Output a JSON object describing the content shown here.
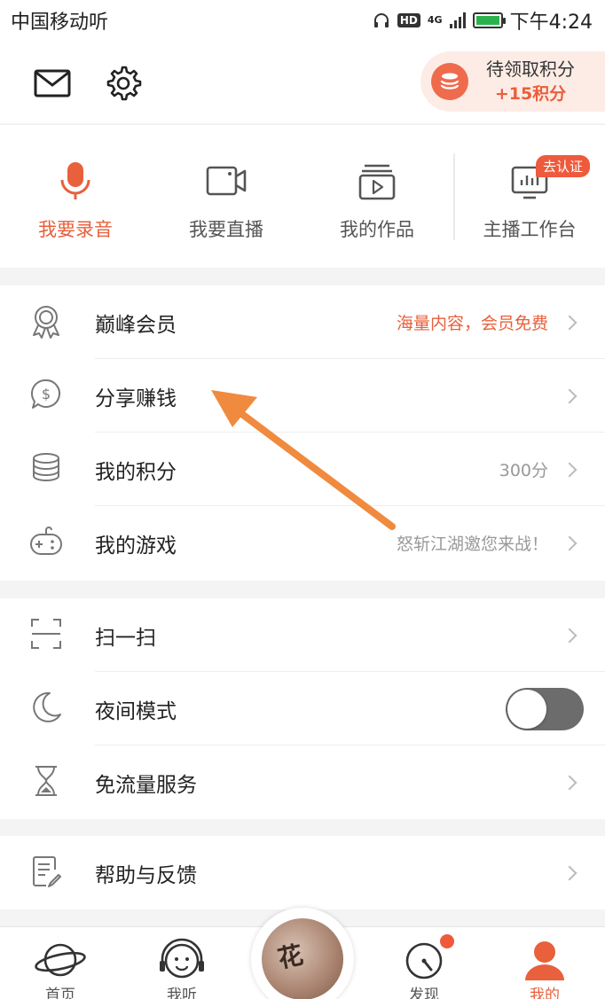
{
  "status_bar": {
    "carrier": "中国移动听",
    "hd": "HD",
    "network": "4G",
    "time": "下午4:24"
  },
  "header": {
    "points_title": "待领取积分",
    "points_value": "+15积分"
  },
  "quick_actions": [
    {
      "label": "我要录音",
      "icon": "microphone-icon"
    },
    {
      "label": "我要直播",
      "icon": "video-camera-icon"
    },
    {
      "label": "我的作品",
      "icon": "play-works-icon"
    },
    {
      "label": "主播工作台",
      "icon": "studio-monitor-icon",
      "badge": "去认证"
    }
  ],
  "menu_group_1": [
    {
      "title": "巅峰会员",
      "sub": "海量内容，会员免费",
      "icon": "medal-icon"
    },
    {
      "title": "分享赚钱",
      "sub": "",
      "icon": "dollar-bubble-icon"
    },
    {
      "title": "我的积分",
      "sub": "300分",
      "icon": "coin-stack-icon"
    },
    {
      "title": "我的游戏",
      "sub": "怒斩江湖邀您来战！",
      "icon": "gamepad-icon"
    }
  ],
  "menu_group_2": [
    {
      "title": "扫一扫",
      "icon": "scan-icon"
    },
    {
      "title": "夜间模式",
      "icon": "moon-icon",
      "toggle": false
    },
    {
      "title": "免流量服务",
      "icon": "hourglass-icon"
    }
  ],
  "menu_group_3": [
    {
      "title": "帮助与反馈",
      "icon": "feedback-icon"
    }
  ],
  "bottom_nav": [
    {
      "label": "首页",
      "icon": "planet-icon"
    },
    {
      "label": "我听",
      "icon": "headphone-face-icon"
    },
    {
      "label": "发现",
      "icon": "compass-icon"
    },
    {
      "label": "我的",
      "icon": "person-icon"
    }
  ],
  "colors": {
    "accent": "#e8603c",
    "badge": "#ee5a3c",
    "annotation_arrow": "#f08a3e"
  }
}
